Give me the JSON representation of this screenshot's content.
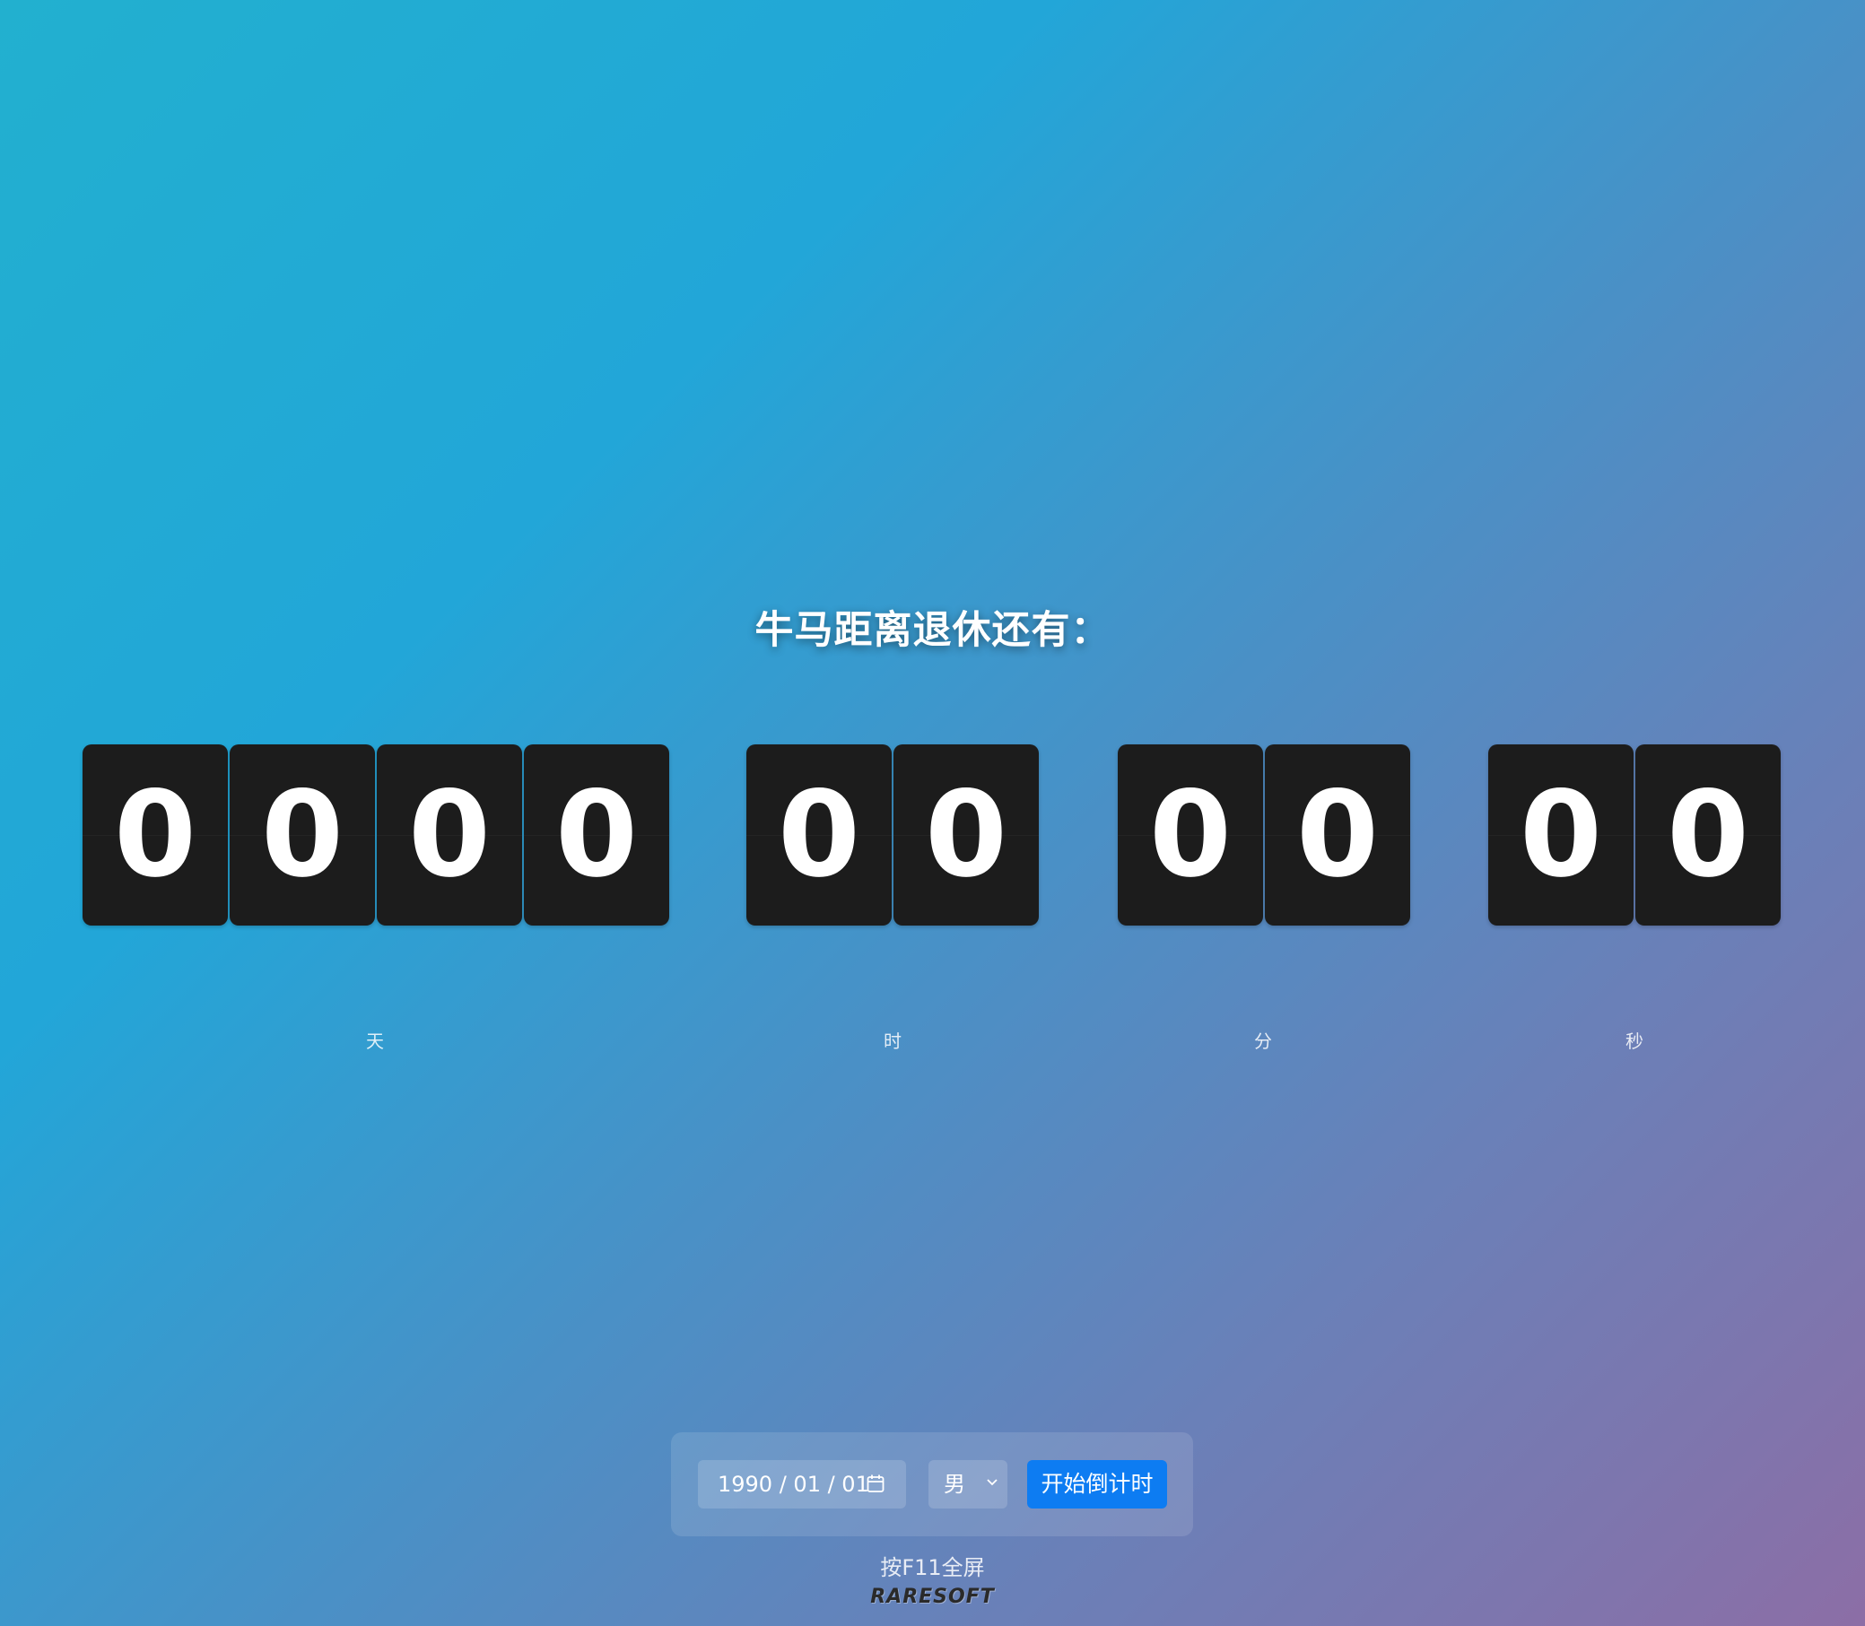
{
  "title": "牛马距离退休还有：",
  "countdown": {
    "days": [
      "0",
      "0",
      "0",
      "0"
    ],
    "hours": [
      "0",
      "0"
    ],
    "minutes": [
      "0",
      "0"
    ],
    "seconds": [
      "0",
      "0"
    ]
  },
  "labels": {
    "days": "天",
    "hours": "时",
    "minutes": "分",
    "seconds": "秒"
  },
  "controls": {
    "birth_date_value": "1990 / 01 / 01",
    "gender_value": "男",
    "start_button_label": "开始倒计时"
  },
  "icons": {
    "calendar": "calendar-icon",
    "dropdown": "chevron-down-icon"
  },
  "hint": "按F11全屏",
  "brand": "RARESOFT",
  "colors": {
    "tile_background": "#1c1c1c",
    "button_blue": "#0d7cf2"
  }
}
